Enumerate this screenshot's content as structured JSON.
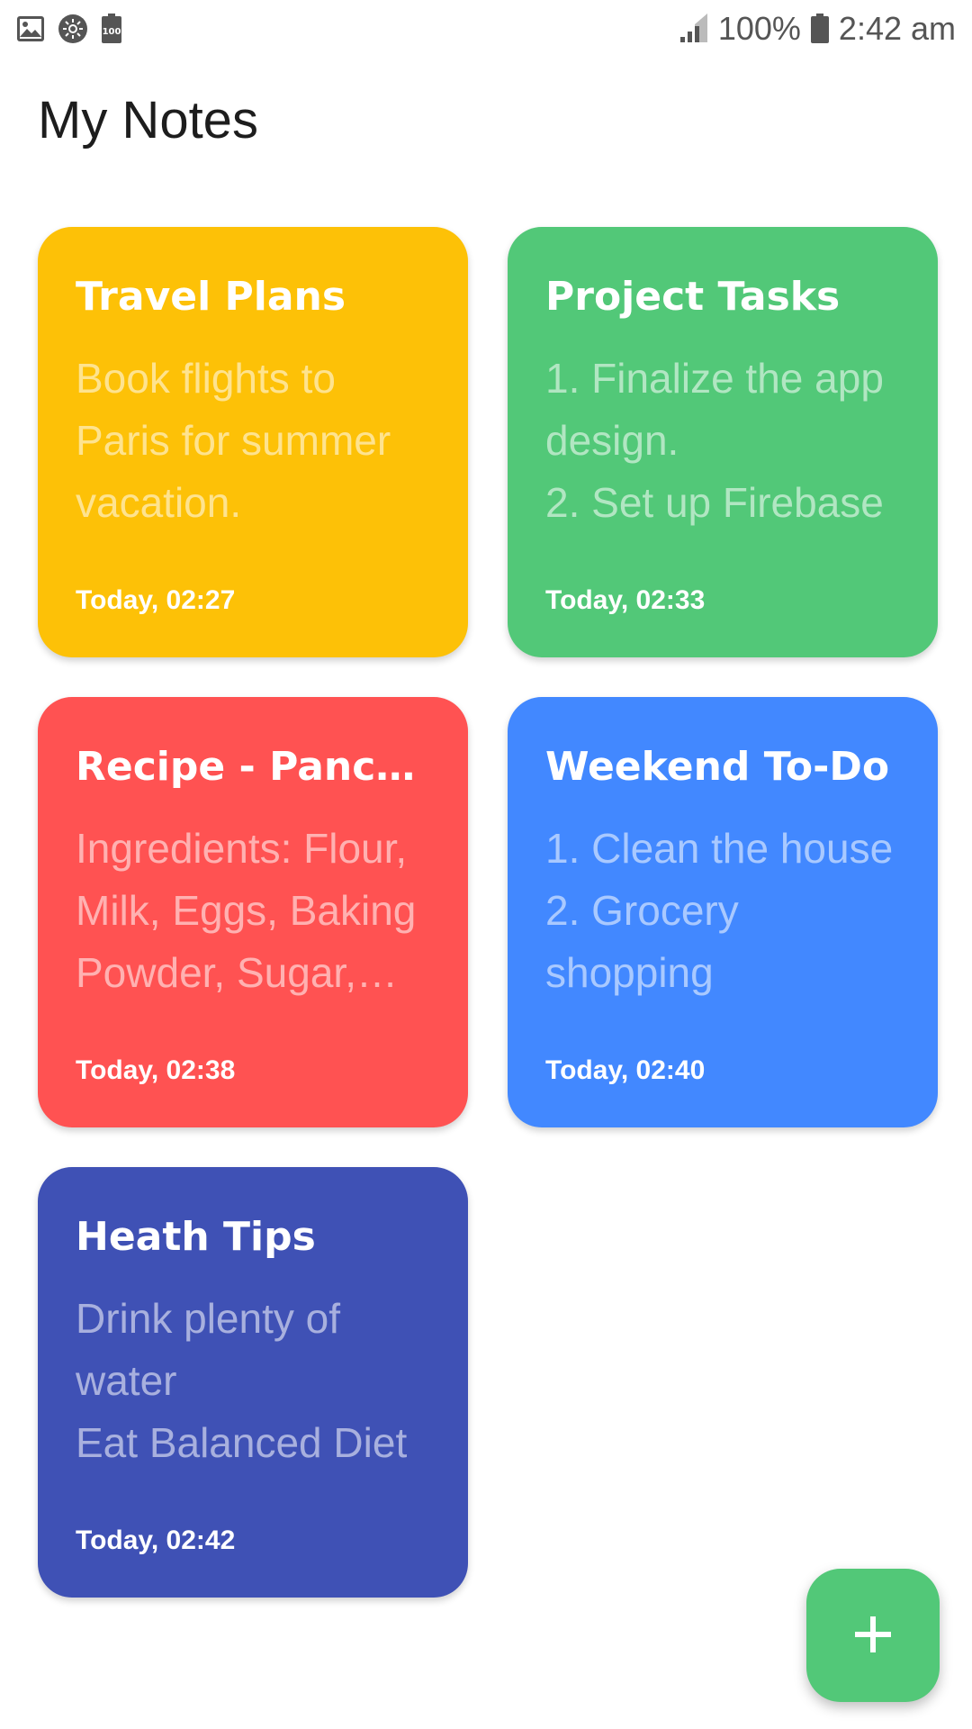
{
  "status_bar": {
    "battery_percent_label": "100%",
    "time": "2:42 am",
    "battery_icon_text": "100"
  },
  "app": {
    "title": "My Notes"
  },
  "colors": {
    "yellow": "#fdc107",
    "green": "#52c878",
    "red": "#ff5252",
    "blue": "#4288ff",
    "indigo": "#3f51b5"
  },
  "notes": [
    {
      "title": "Travel Plans",
      "body": "Book flights to Paris for summer vacation.",
      "date": "Today, 02:27",
      "color": "#fdc107"
    },
    {
      "title": "Project Tasks",
      "body": "1. Finalize the app design.\n2. Set up Firebase",
      "date": "Today, 02:33",
      "color": "#52c878"
    },
    {
      "title": "Recipe - Pancakes",
      "body": "Ingredients: Flour, Milk, Eggs, Baking Powder, Sugar, Salt",
      "date": "Today, 02:38",
      "color": "#ff5252"
    },
    {
      "title": "Weekend To-Do",
      "body": "1. Clean the house\n2. Grocery shopping",
      "date": "Today, 02:40",
      "color": "#4288ff"
    },
    {
      "title": "Heath Tips",
      "body": "Drink plenty of water\nEat Balanced Diet",
      "date": "Today, 02:42",
      "color": "#3f51b5"
    }
  ],
  "fab": {
    "icon": "plus-icon"
  }
}
